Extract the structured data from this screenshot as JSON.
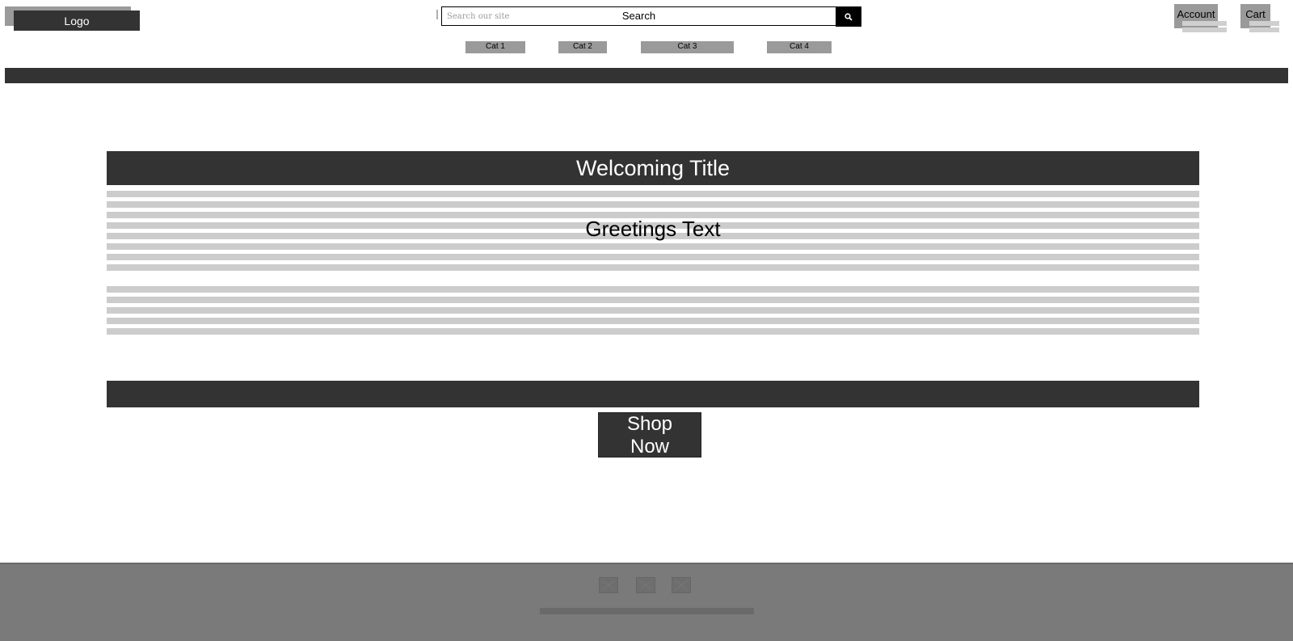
{
  "header": {
    "logo_label": "Logo",
    "search": {
      "placeholder": "Search our site",
      "label": "Search"
    },
    "account_label": "Account",
    "cart_label": "Cart"
  },
  "categories": [
    {
      "label": "Cat 1"
    },
    {
      "label": "Cat 2"
    },
    {
      "label": "Cat 3"
    },
    {
      "label": "Cat 4"
    }
  ],
  "hero": {
    "title": "Welcoming Title",
    "greeting": "Greetings Text",
    "cta_label": "Shop Now"
  },
  "footer": {
    "social_icons": [
      "social-icon-1",
      "social-icon-2",
      "social-icon-3"
    ]
  },
  "colors": {
    "dark": "#333333",
    "mid_gray": "#9a9a9a",
    "light_gray": "#cccccc",
    "footer_gray": "#7a7a7a"
  }
}
